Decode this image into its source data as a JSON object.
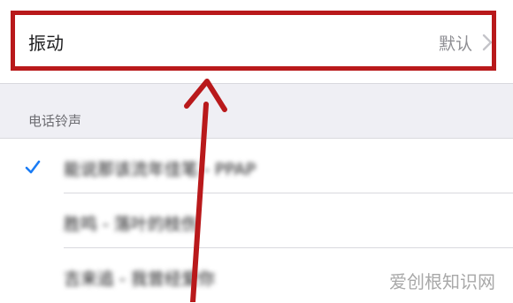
{
  "vibration": {
    "label": "振动",
    "value": "默认"
  },
  "ringtone_section": {
    "header": "电话铃声",
    "items": [
      {
        "label": "能说那该流年佳笔 - PPAP",
        "selected": true
      },
      {
        "label": "胜鸣 - 落叶的枝伤",
        "selected": false
      },
      {
        "label": "吉来追 - 我曾经爱你",
        "selected": false
      }
    ]
  },
  "colors": {
    "highlight": "#b9191b",
    "accent": "#1a7cf5"
  },
  "icons": {
    "chevron": "chevron-right-icon",
    "check": "checkmark-icon"
  },
  "watermark": "爱创根知识网"
}
